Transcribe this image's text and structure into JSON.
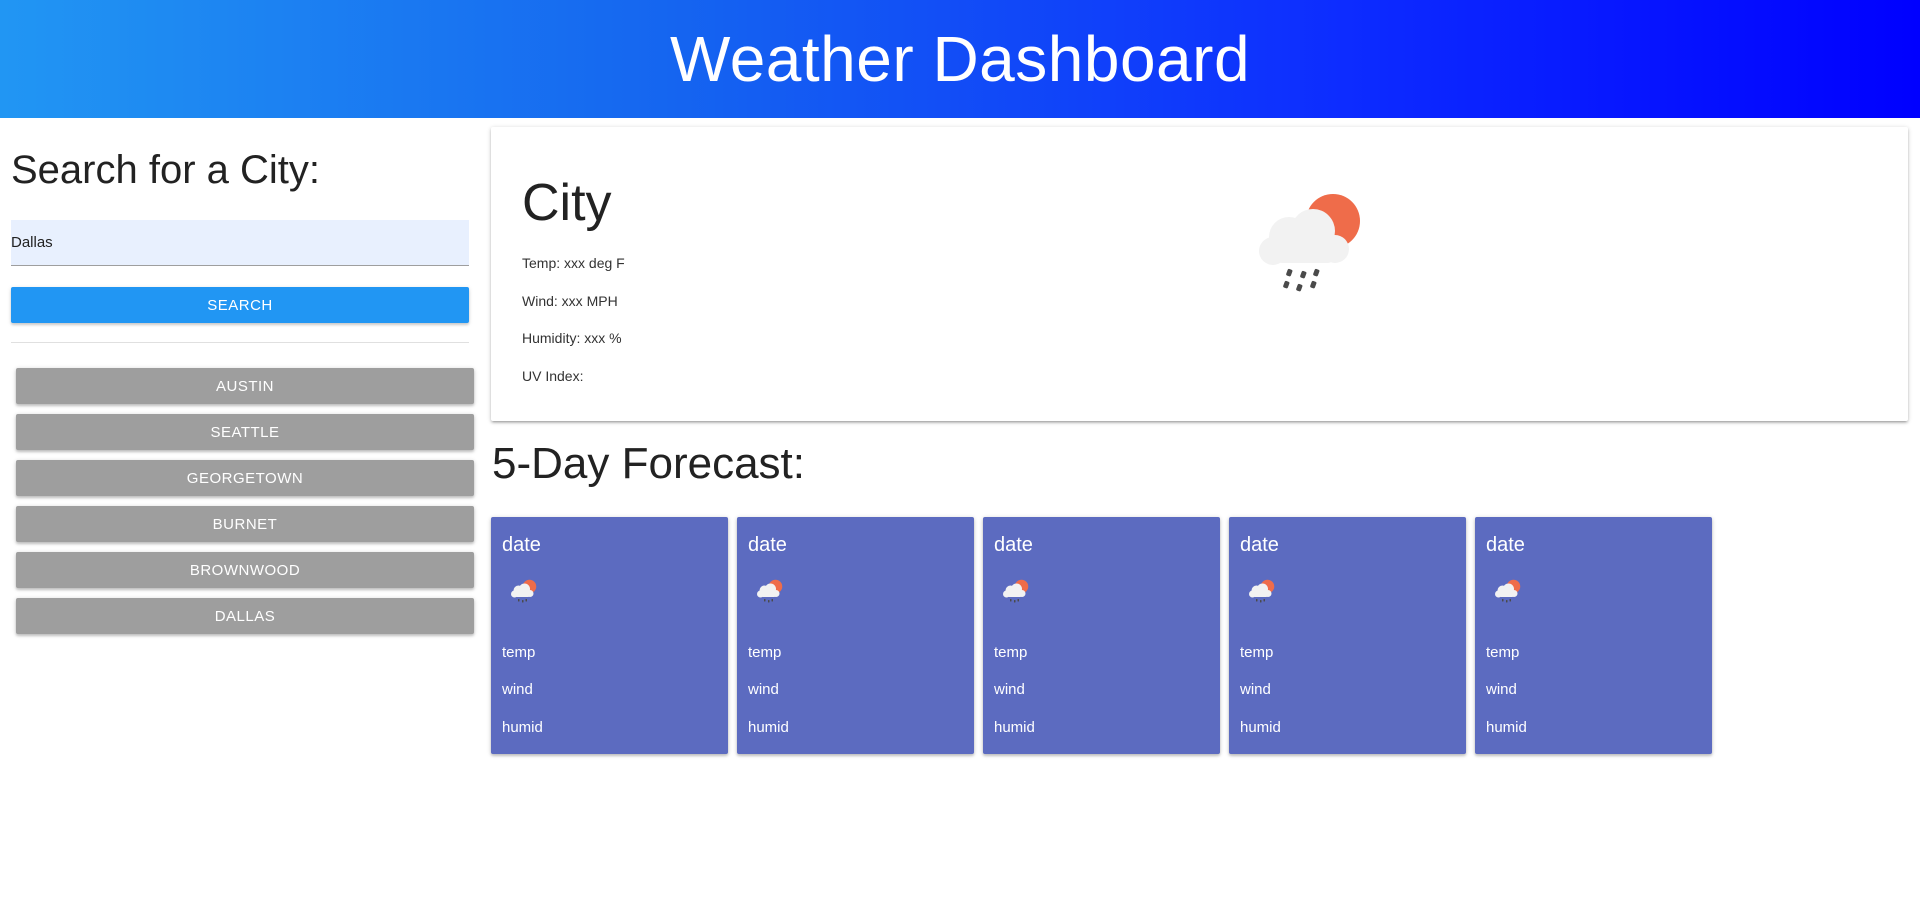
{
  "header": {
    "title": "Weather Dashboard"
  },
  "sidebar": {
    "heading": "Search for a City:",
    "search_value": "Dallas",
    "search_button": "SEARCH",
    "history": [
      "AUSTIN",
      "SEATTLE",
      "GEORGETOWN",
      "BURNET",
      "BROWNWOOD",
      "DALLAS"
    ]
  },
  "current": {
    "city": "City",
    "temp": "Temp: xxx deg F",
    "wind": "Wind: xxx MPH",
    "humidity": "Humidity: xxx %",
    "uv": "UV Index:",
    "icon": "partly-cloudy-rain-icon"
  },
  "forecast": {
    "title": "5-Day Forecast:",
    "days": [
      {
        "date": "date",
        "temp": "temp",
        "wind": "wind",
        "humid": "humid",
        "icon": "partly-cloudy-rain-icon"
      },
      {
        "date": "date",
        "temp": "temp",
        "wind": "wind",
        "humid": "humid",
        "icon": "partly-cloudy-rain-icon"
      },
      {
        "date": "date",
        "temp": "temp",
        "wind": "wind",
        "humid": "humid",
        "icon": "partly-cloudy-rain-icon"
      },
      {
        "date": "date",
        "temp": "temp",
        "wind": "wind",
        "humid": "humid",
        "icon": "partly-cloudy-rain-icon"
      },
      {
        "date": "date",
        "temp": "temp",
        "wind": "wind",
        "humid": "humid",
        "icon": "partly-cloudy-rain-icon"
      }
    ]
  },
  "colors": {
    "header_start": "#2196f3",
    "header_end": "#0000ff",
    "search_button": "#2196f3",
    "history_button": "#9e9e9e",
    "forecast_card": "#5c6bc0",
    "sun": "#ef6c4a"
  }
}
